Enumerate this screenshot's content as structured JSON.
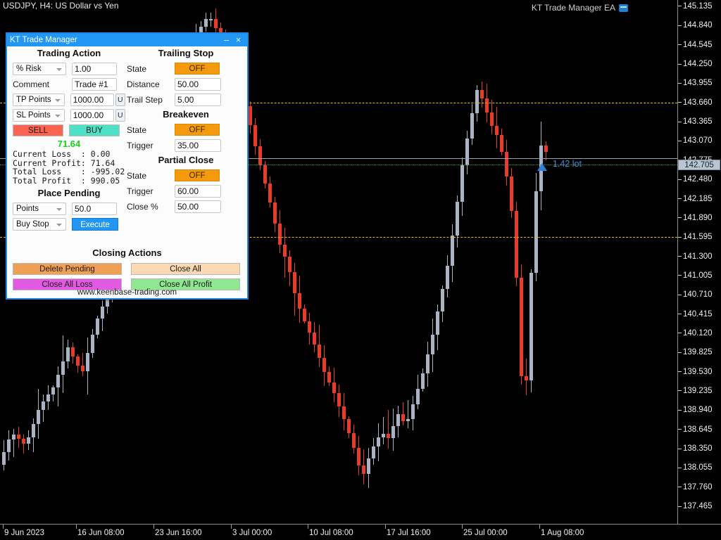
{
  "chart": {
    "symbol_line": "USDJPY, H4:  US Dollar vs Yen",
    "ea_label": "KT Trade Manager EA",
    "ea_icon": "ea-badge-icon",
    "position_label": "1.42 lot",
    "current_price": "142.705",
    "price_ticks": [
      "145.135",
      "144.840",
      "144.545",
      "144.250",
      "143.955",
      "143.660",
      "143.365",
      "143.070",
      "142.775",
      "142.480",
      "142.185",
      "141.890",
      "141.595",
      "141.300",
      "141.005",
      "140.710",
      "140.415",
      "140.120",
      "139.825",
      "139.530",
      "139.235",
      "138.940",
      "138.645",
      "138.350",
      "138.055",
      "137.760",
      "137.465"
    ],
    "time_ticks": [
      "9 Jun 2023",
      "16 Jun 08:00",
      "23 Jun 16:00",
      "3 Jul 00:00",
      "10 Jul 08:00",
      "17 Jul 16:00",
      "25 Jul 00:00",
      "1 Aug 08:00"
    ],
    "colors": {
      "bg": "#000000",
      "bull": "#aab4c4",
      "bear": "#e83b2a",
      "tp_line": "#e8c000",
      "entry_line": "#2fa82f",
      "cross_line": "#9aa2ab",
      "marker": "#2e7fd6"
    }
  },
  "chart_data": {
    "type": "candlestick",
    "title": "USDJPY, H4: US Dollar vs Yen",
    "xlabel": "",
    "ylabel": "",
    "ylim": [
      137.3,
      145.3
    ],
    "grid": false,
    "categories": [
      "9 Jun 2023",
      "16 Jun 08:00",
      "23 Jun 16:00",
      "3 Jul 00:00",
      "10 Jul 08:00",
      "17 Jul 16:00",
      "25 Jul 00:00",
      "1 Aug 08:00"
    ],
    "levels": [
      {
        "name": "take-profit-line",
        "value": 143.66,
        "style": "dash-dot",
        "color": "#e8c000"
      },
      {
        "name": "stop-loss-line",
        "value": 141.595,
        "style": "dash-dot",
        "color": "#e8c000"
      },
      {
        "name": "entry-line",
        "value": 142.705,
        "style": "dotted",
        "color": "#2fa82f"
      },
      {
        "name": "crosshair-line",
        "value": 142.8,
        "style": "solid",
        "color": "#9aa2ab"
      }
    ],
    "annotations": [
      {
        "text": "1.42 lot",
        "price": 142.705,
        "time": "1 Aug 08:00",
        "color": "#3f8fdc"
      }
    ]
  },
  "panel": {
    "title": "KT Trade Manager",
    "minimize_label": "–",
    "close_label": "×",
    "footer": "www.keenbase-trading.com",
    "trading_action": {
      "heading": "Trading Action",
      "lot_mode": "% Risk",
      "lot_value": "1.00",
      "comment_label": "Comment",
      "comment_value": "Trade #1",
      "tp_mode": "TP Points",
      "tp_value": "1000.00",
      "tp_unit": "U",
      "sl_mode": "SL Points",
      "sl_value": "1000.00",
      "sl_unit": "U",
      "sell_label": "SELL",
      "buy_label": "BUY"
    },
    "stats": {
      "profit_big": "71.64",
      "lines": [
        "Current Loss  : 0.00",
        "Current Profit: 71.64",
        "Total Loss    : -995.02",
        "Total Profit  : 990.05"
      ]
    },
    "place_pending": {
      "heading": "Place Pending",
      "unit_mode": "Points",
      "distance_value": "50.0",
      "order_type": "Buy Stop",
      "execute_label": "Execute"
    },
    "trailing_stop": {
      "heading": "Trailing Stop",
      "state_label": "State",
      "state_value": "OFF",
      "distance_label": "Distance",
      "distance_value": "50.00",
      "trail_step_label": "Trail Step",
      "trail_step_value": "5.00"
    },
    "breakeven": {
      "heading": "Breakeven",
      "state_label": "State",
      "state_value": "OFF",
      "trigger_label": "Trigger",
      "trigger_value": "35.00"
    },
    "partial_close": {
      "heading": "Partial Close",
      "state_label": "State",
      "state_value": "OFF",
      "trigger_label": "Trigger",
      "trigger_value": "60.00",
      "close_pct_label": "Close %",
      "close_pct_value": "50.00"
    },
    "closing_actions": {
      "heading": "Closing Actions",
      "delete_pending": "Delete Pending",
      "close_all": "Close All",
      "close_all_loss": "Close All Loss",
      "close_all_profit": "Close All Profit"
    }
  }
}
